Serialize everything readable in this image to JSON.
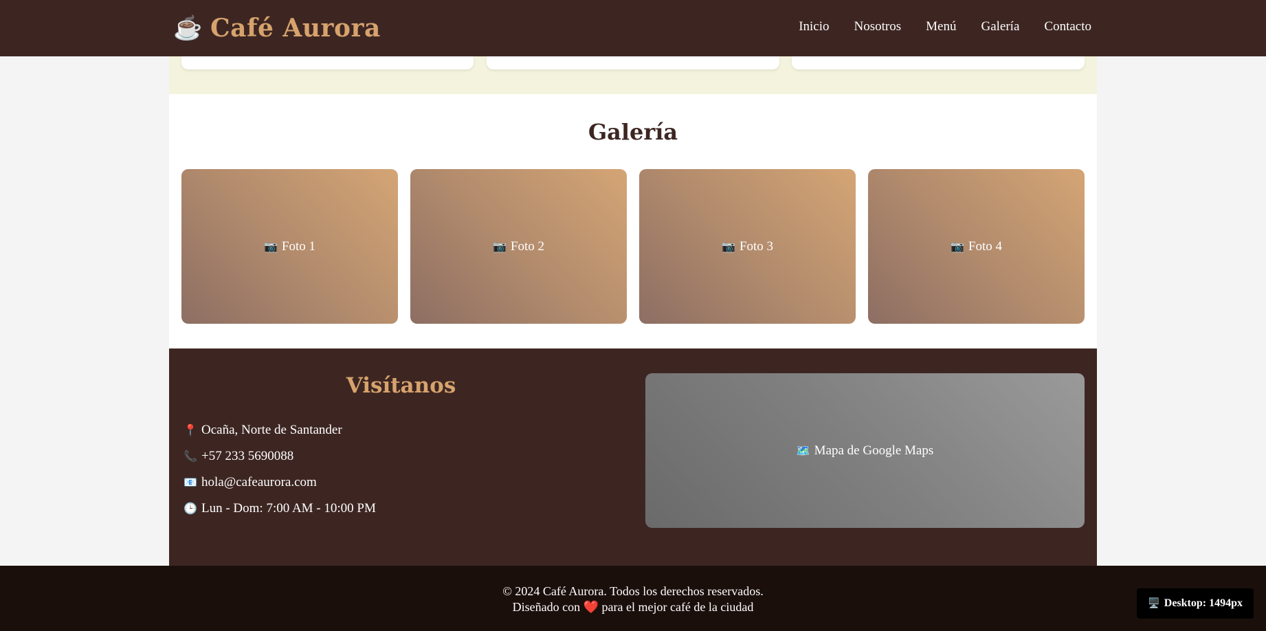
{
  "header": {
    "logo_icon": "coffee-cup-icon",
    "logo_text": "Café Aurora",
    "nav": [
      {
        "label": "Inicio"
      },
      {
        "label": "Nosotros"
      },
      {
        "label": "Menú"
      },
      {
        "label": "Galería"
      },
      {
        "label": "Contacto"
      }
    ]
  },
  "gallery": {
    "title": "Galería",
    "photos": [
      {
        "icon": "camera-icon",
        "label": "Foto 1"
      },
      {
        "icon": "camera-icon",
        "label": "Foto 2"
      },
      {
        "icon": "camera-icon",
        "label": "Foto 3"
      },
      {
        "icon": "camera-icon",
        "label": "Foto 4"
      }
    ]
  },
  "contact": {
    "title": "Visítanos",
    "items": [
      {
        "icon": "pin-icon",
        "text": "Ocaña, Norte de Santander"
      },
      {
        "icon": "phone-icon",
        "text": "+57 233 5690088"
      },
      {
        "icon": "email-icon",
        "text": "hola@cafeaurora.com"
      },
      {
        "icon": "clock-icon",
        "text": "Lun - Dom: 7:00 AM - 10:00 PM"
      }
    ],
    "map": {
      "icon": "map-icon",
      "label": "Mapa de Google Maps"
    }
  },
  "footer": {
    "copyright": "© 2024 Café Aurora. Todos los derechos reservados.",
    "designed_prefix": "Diseñado con",
    "designed_suffix": "para el mejor café de la ciudad",
    "heart_icon": "heart-icon"
  },
  "viewport_badge": {
    "icon": "desktop-icon",
    "label": "Desktop: 1494px"
  },
  "colors": {
    "header_bg": "#3d2622",
    "accent": "#d7a36d",
    "services_bg": "#f4f3dd",
    "footer_bg": "#1b0f0c"
  }
}
